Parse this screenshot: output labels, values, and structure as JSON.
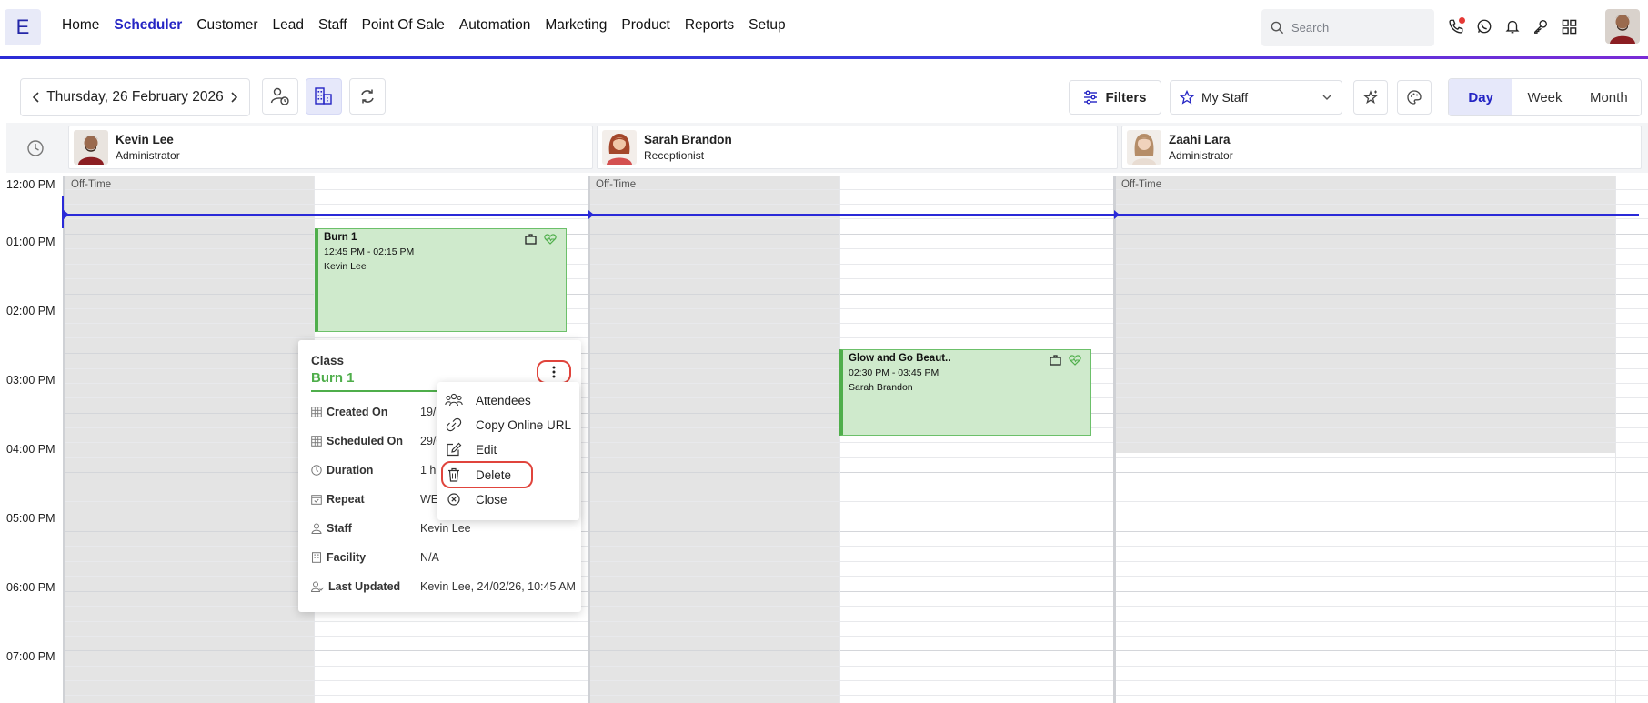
{
  "app": {
    "logo_letter": "E",
    "nav": [
      "Home",
      "Scheduler",
      "Customer",
      "Lead",
      "Staff",
      "Point Of Sale",
      "Automation",
      "Marketing",
      "Product",
      "Reports",
      "Setup"
    ],
    "active_nav": "Scheduler",
    "search_placeholder": "Search",
    "brand_color": "#2424c4"
  },
  "toolbar": {
    "date": "Thursday, 26 February 2026",
    "filters_label": "Filters",
    "staff_filter": "My Staff",
    "views": [
      "Day",
      "Week",
      "Month"
    ],
    "active_view": "Day"
  },
  "staff": [
    {
      "name": "Kevin Lee",
      "role": "Administrator"
    },
    {
      "name": "Sarah Brandon",
      "role": "Receptionist"
    },
    {
      "name": "Zaahi Lara",
      "role": "Administrator"
    }
  ],
  "time_labels": [
    "12:00 PM",
    "01:00 PM",
    "02:00 PM",
    "03:00 PM",
    "04:00 PM",
    "05:00 PM",
    "06:00 PM",
    "07:00 PM"
  ],
  "offtime_label": "Off-Time",
  "events": [
    {
      "title": "Burn 1",
      "time": "12:45 PM - 02:15 PM",
      "staff": "Kevin Lee"
    },
    {
      "title": "Glow and Go Beaut..",
      "time": "02:30 PM - 03:45 PM",
      "staff": "Sarah Brandon"
    }
  ],
  "popover": {
    "type": "Class",
    "name": "Burn 1",
    "rows": [
      {
        "label": "Created On",
        "value": "19/1"
      },
      {
        "label": "Scheduled On",
        "value": "29/0"
      },
      {
        "label": "Duration",
        "value": "1 hr"
      },
      {
        "label": "Repeat",
        "value": "WE"
      },
      {
        "label": "Staff",
        "value": "Kevin Lee"
      },
      {
        "label": "Facility",
        "value": "N/A"
      },
      {
        "label": "Last Updated",
        "value": "Kevin Lee, 24/02/26, 10:45 AM"
      }
    ]
  },
  "menu": {
    "attendees": "Attendees",
    "copy_url": "Copy Online URL",
    "edit": "Edit",
    "delete": "Delete",
    "close": "Close"
  }
}
